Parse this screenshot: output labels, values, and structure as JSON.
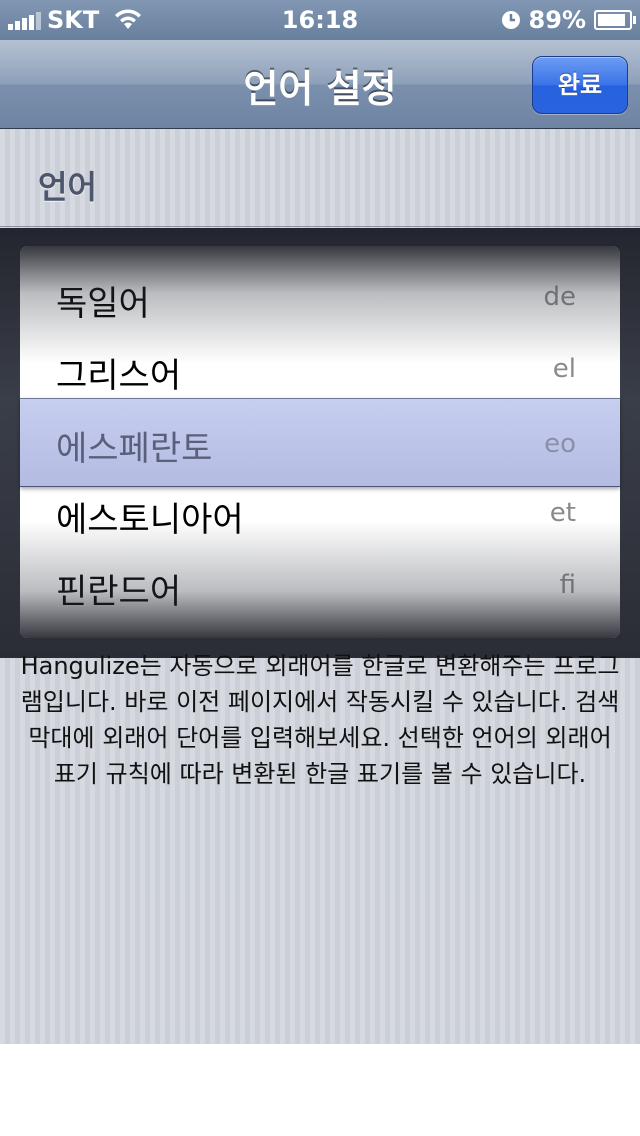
{
  "status_bar": {
    "carrier": "SKT",
    "time": "16:18",
    "battery": "89%"
  },
  "nav": {
    "title": "언어 설정",
    "done_label": "완료"
  },
  "section": {
    "header": "언어"
  },
  "picker": {
    "items": [
      {
        "name": "독일어",
        "code": "de"
      },
      {
        "name": "그리스어",
        "code": "el"
      },
      {
        "name": "에스페란토",
        "code": "eo"
      },
      {
        "name": "에스토니아어",
        "code": "et"
      },
      {
        "name": "핀란드어",
        "code": "fi"
      }
    ],
    "selected": {
      "name": "에스페란토",
      "code": "eo"
    }
  },
  "footer": {
    "description": "Hangulize는 자동으로 외래어를 한글로 변환해주는 프로그램입니다. 바로 이전 페이지에서 작동시킬 수 있습니다. 검색 막대에 외래어 단어를 입력해보세요. 선택한 언어의 외래어 표기 규칙에 따라 변환된 한글 표기를 볼 수 있습니다."
  }
}
